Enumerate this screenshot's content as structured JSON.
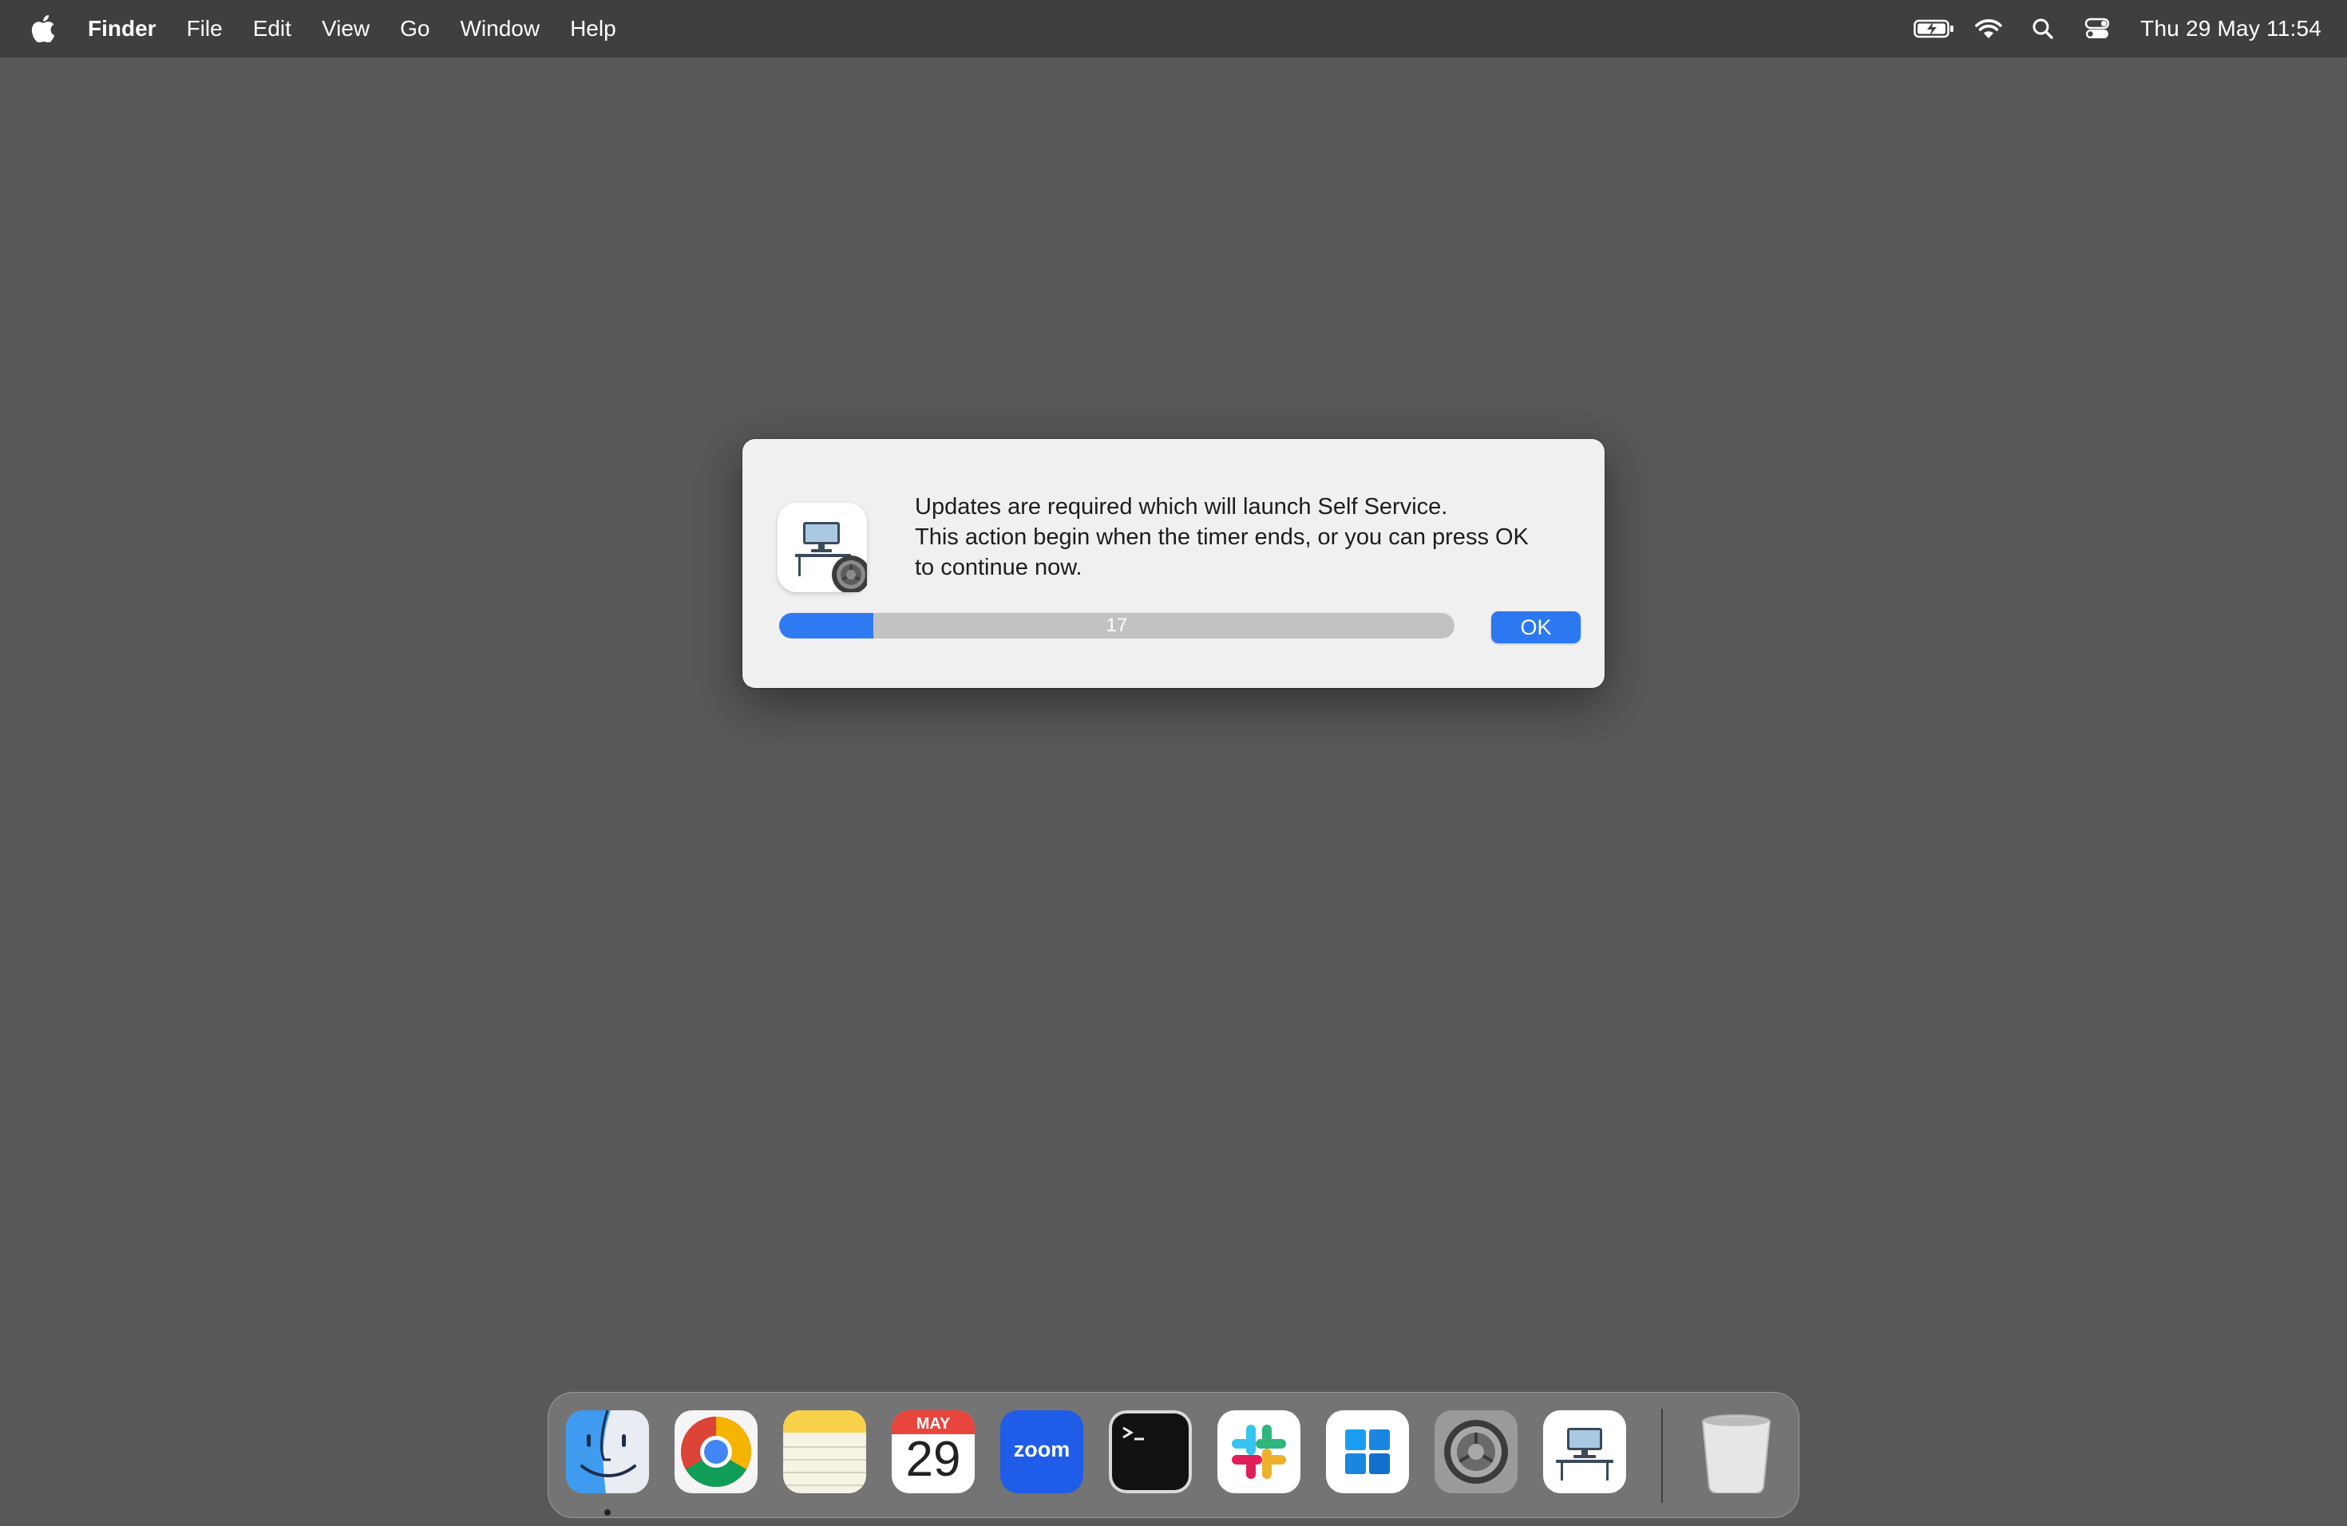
{
  "menubar": {
    "app_name": "Finder",
    "menus": [
      "File",
      "Edit",
      "View",
      "Go",
      "Window",
      "Help"
    ],
    "status_icons": [
      "battery-charging-icon",
      "wifi-icon",
      "spotlight-search-icon",
      "control-center-icon"
    ],
    "clock": "Thu 29 May  11:54"
  },
  "dialog": {
    "icon": "self-service-icon",
    "lines": [
      "Updates are required which will launch Self Service.",
      "This action begin when the timer ends, or you can press OK",
      "to continue now."
    ],
    "timer_value": "17",
    "timer_progress_fraction": 0.14,
    "ok_label": "OK",
    "accent_color": "#2c78f0"
  },
  "dock": {
    "apps": [
      "finder-icon",
      "chrome-icon",
      "notes-icon",
      "calendar-icon",
      "zoom-icon",
      "terminal-icon",
      "slack-icon",
      "windows-app-icon",
      "system-settings-icon",
      "self-service-icon"
    ],
    "calendar_month": "MAY",
    "calendar_day": "29",
    "zoom_label": "zoom",
    "trash": "trash-icon"
  }
}
